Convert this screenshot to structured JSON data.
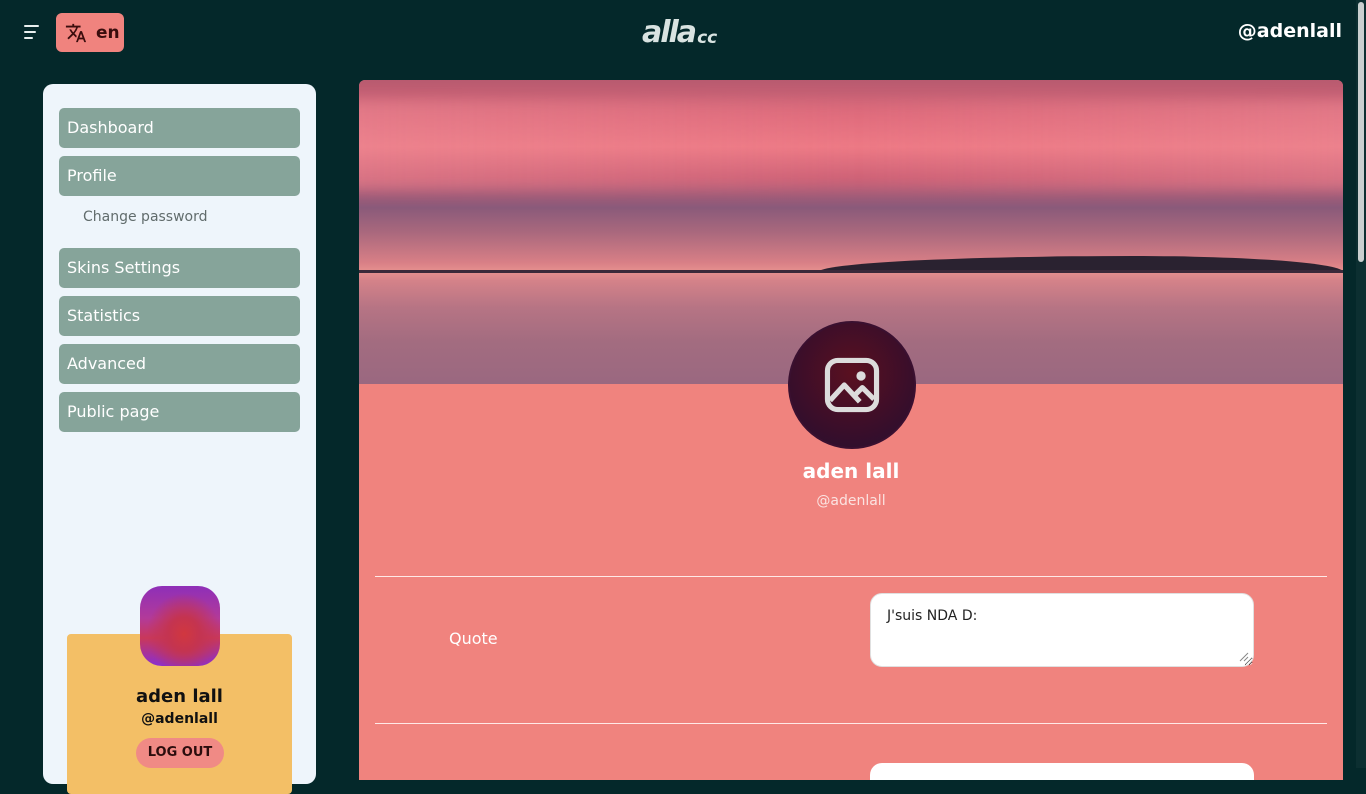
{
  "header": {
    "language": "en",
    "logo_main": "alla",
    "logo_suffix": "cc",
    "user_handle": "@adenlall"
  },
  "sidebar": {
    "items": [
      {
        "label": "Dashboard"
      },
      {
        "label": "Profile"
      },
      {
        "label": "Skins Settings"
      },
      {
        "label": "Statistics"
      },
      {
        "label": "Advanced"
      },
      {
        "label": "Public page"
      }
    ],
    "sub_item": "Change password",
    "card": {
      "name": "aden lall",
      "handle": "@adenlall",
      "logout_label": "LOG OUT"
    }
  },
  "profile": {
    "name": "aden lall",
    "handle": "@adenlall",
    "quote_label": "Quote",
    "quote_value": "J'suis NDA D:"
  },
  "colors": {
    "page_background": "#04282a",
    "accent": "#f0837e",
    "nav_item": "#86a49a",
    "card": "#f3bf66"
  }
}
